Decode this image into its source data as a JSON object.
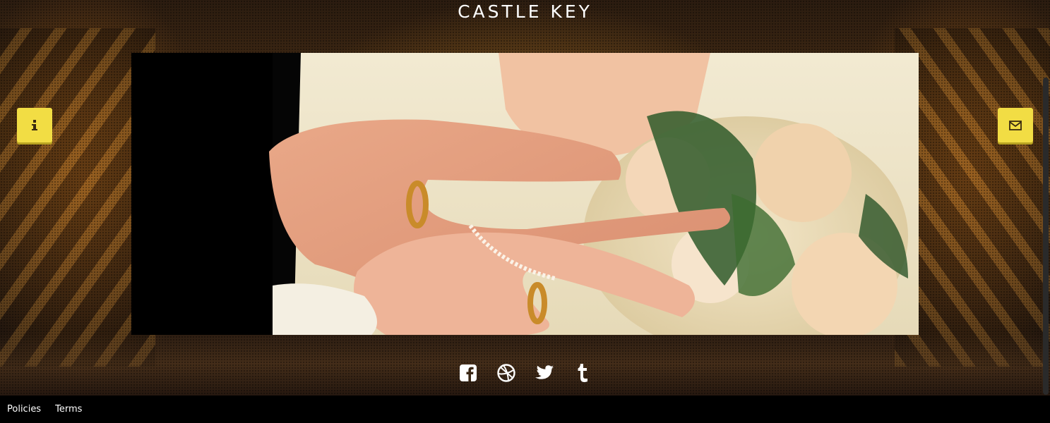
{
  "site": {
    "title": "CASTLE KEY"
  },
  "side_buttons": {
    "left_icon": "info-icon",
    "right_icon": "envelope-icon",
    "color": "#f2dd44"
  },
  "hero": {
    "image": "wedding-rings-bouquet-photo"
  },
  "social": {
    "icons": [
      "facebook-icon",
      "dribbble-icon",
      "twitter-icon",
      "tumblr-icon"
    ]
  },
  "footer": {
    "links": [
      {
        "label": "Policies"
      },
      {
        "label": "Terms"
      }
    ]
  }
}
